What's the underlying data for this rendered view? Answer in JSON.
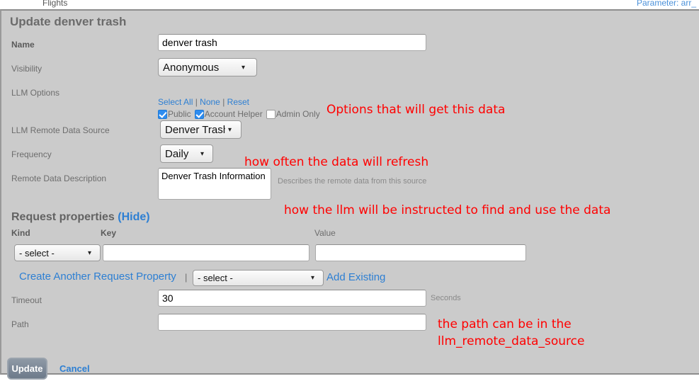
{
  "top_bar": {
    "tab_label": "Flights",
    "parameter_label": "Parameter: arr_"
  },
  "form": {
    "title": "Update denver trash",
    "rows": {
      "name": {
        "label": "Name",
        "value": "denver trash"
      },
      "visibility": {
        "label": "Visibility",
        "value": "Anonymous"
      },
      "llm_options": {
        "label": "LLM Options",
        "select_all": "Select All",
        "none": "None",
        "reset": "Reset",
        "separator": "|",
        "checkboxes": [
          {
            "label": "Public",
            "checked": true
          },
          {
            "label": "Account Helper",
            "checked": true
          },
          {
            "label": "Admin Only",
            "checked": false
          }
        ]
      },
      "llm_remote_data_source": {
        "label": "LLM Remote Data Source",
        "value": "Denver Trash?"
      },
      "frequency": {
        "label": "Frequency",
        "value": "Daily"
      },
      "remote_data_description": {
        "label": "Remote Data Description",
        "value": "Denver Trash Information",
        "hint": "Describes the remote data from this source"
      },
      "timeout": {
        "label": "Timeout",
        "value": "30",
        "hint": "Seconds"
      },
      "path": {
        "label": "Path",
        "value": "",
        "placeholder": ""
      }
    },
    "request_properties": {
      "heading": "Request properties",
      "hide_link": "(Hide)",
      "columns": {
        "kind": "Kind",
        "key": "Key",
        "value": "Value"
      },
      "kind_value": "- select -",
      "key_value": "",
      "value_value": "",
      "create_another_link": "Create Another Request Property",
      "separator": "|",
      "existing_select_value": "- select -",
      "add_existing_link": "Add Existing"
    },
    "actions": {
      "update_label": "Update",
      "cancel_label": "Cancel"
    }
  },
  "annotations": [
    {
      "text": "Options that will get this data"
    },
    {
      "text": "how often the data will refresh"
    },
    {
      "text": "how the llm will be instructed to find and use the data"
    },
    {
      "text": "the path can be in the"
    },
    {
      "text": "llm_remote_data_source"
    }
  ],
  "colors": {
    "panel_bg": "#cbcbcb",
    "link_blue": "#2d7fd3",
    "annotation_red": "#ff0000",
    "checkbox_blue": "#2d8cf0"
  }
}
